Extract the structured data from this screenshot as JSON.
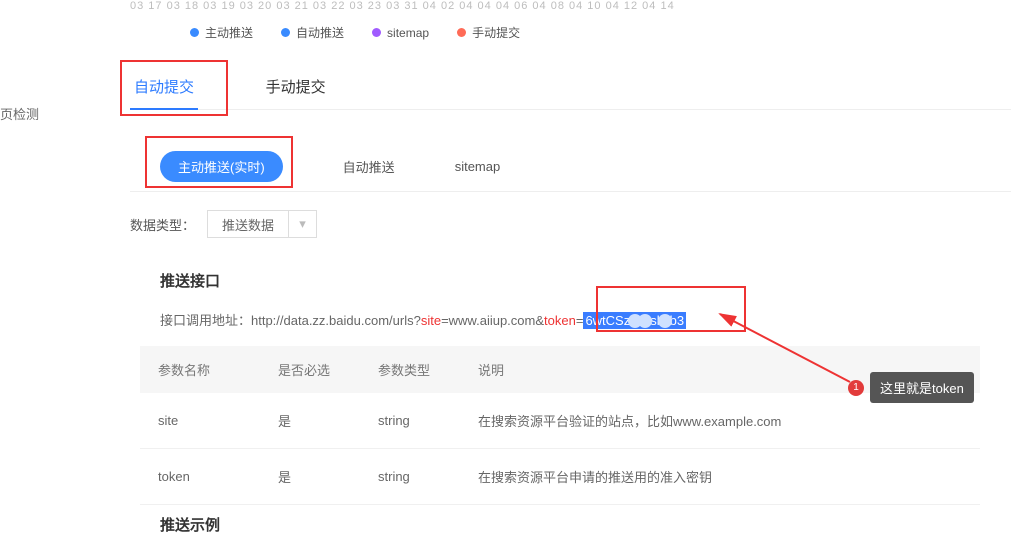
{
  "sidebar": {
    "fragment_label": "页检测"
  },
  "chart_axis_fragment": "03 17    03 18    03 19    03 20    03 21    03 22    03 23    03 31    04 02    04 04    04 06    04 08    04 10    04 12    04 14",
  "legend": [
    {
      "label": "主动推送",
      "color": "#3a8bff"
    },
    {
      "label": "自动推送",
      "color": "#3a8bff"
    },
    {
      "label": "sitemap",
      "color": "#a05bff"
    },
    {
      "label": "手动提交",
      "color": "#ff6b57"
    }
  ],
  "tabs": {
    "items": [
      {
        "label": "自动提交",
        "active": true
      },
      {
        "label": "手动提交",
        "active": false
      }
    ]
  },
  "subtabs": {
    "active_pill": "主动推送(实时)",
    "items": [
      "自动推送",
      "sitemap"
    ]
  },
  "data_type": {
    "label": "数据类型：",
    "selected": "推送数据"
  },
  "api_section": {
    "title": "推送接口",
    "url_prefix": "接口调用地址：http://data.zz.baidu.com/urls?",
    "site_key": "site",
    "site_val": "=www.aiiup.com&",
    "token_key": "token",
    "token_eq": "=",
    "token_val_visible": "6wtCSz        sl    b3"
  },
  "param_table": {
    "headers": [
      "参数名称",
      "是否必选",
      "参数类型",
      "说明"
    ],
    "rows": [
      {
        "name": "site",
        "required": "是",
        "type": "string",
        "desc": "在搜索资源平台验证的站点，比如www.example.com"
      },
      {
        "name": "token",
        "required": "是",
        "type": "string",
        "desc": "在搜索资源平台申请的推送用的准入密钥"
      }
    ]
  },
  "example_section": {
    "title": "推送示例"
  },
  "callout": {
    "index": "1",
    "text": "这里就是token"
  }
}
